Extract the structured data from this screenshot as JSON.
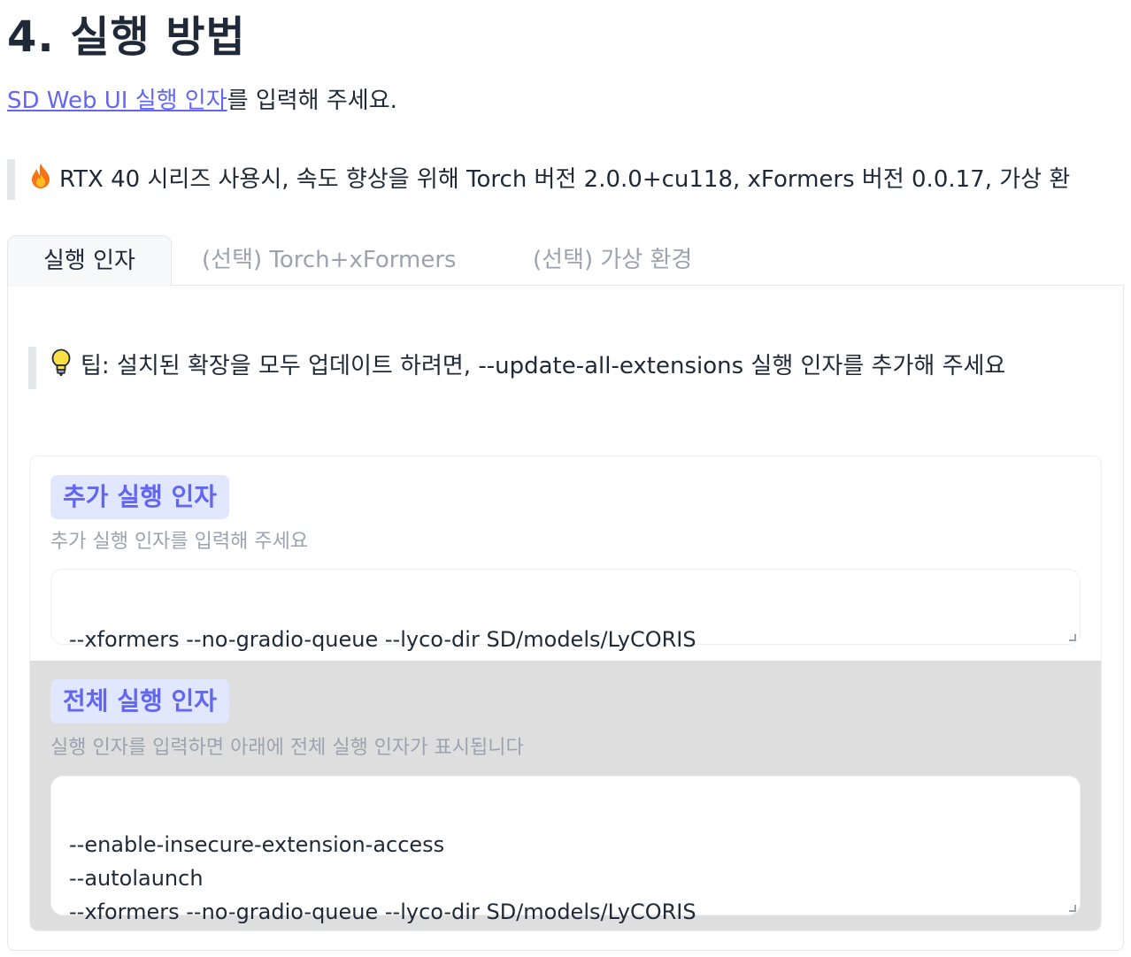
{
  "section": {
    "title": "4. 실행 방법",
    "intro_link": "SD Web UI 실행 인자",
    "intro_text": "를 입력해 주세요."
  },
  "notice": {
    "icon": "fire-icon",
    "text": "RTX 40 시리즈 사용시, 속도 향상을 위해 Torch 버전 2.0.0+cu118, xFormers 버전 0.0.17, 가상 환"
  },
  "tabs": [
    {
      "label": "실행 인자",
      "active": true
    },
    {
      "label": "(선택) Torch+xFormers",
      "active": false
    },
    {
      "label": "(선택) 가상 환경",
      "active": false
    }
  ],
  "tip": {
    "icon": "lightbulb-icon",
    "text": "팁: 설치된 확장을 모두 업데이트 하려면, --update-all-extensions 실행 인자를 추가해 주세요"
  },
  "extra_args": {
    "label": "추가 실행 인자",
    "hint": "추가 실행 인자를 입력해 주세요",
    "value": "--xformers --no-gradio-queue --lyco-dir SD/models/LyCORIS"
  },
  "full_args": {
    "label": "전체 실행 인자",
    "hint": "실행 인자를 입력하면 아래에 전체 실행 인자가 표시됩니다",
    "value": "--enable-insecure-extension-access\n--autolaunch\n--xformers --no-gradio-queue --lyco-dir SD/models/LyCORIS"
  },
  "colors": {
    "accent": "#6366f1",
    "chip_bg": "#e0e7ff",
    "result_bg": "#dedede"
  }
}
